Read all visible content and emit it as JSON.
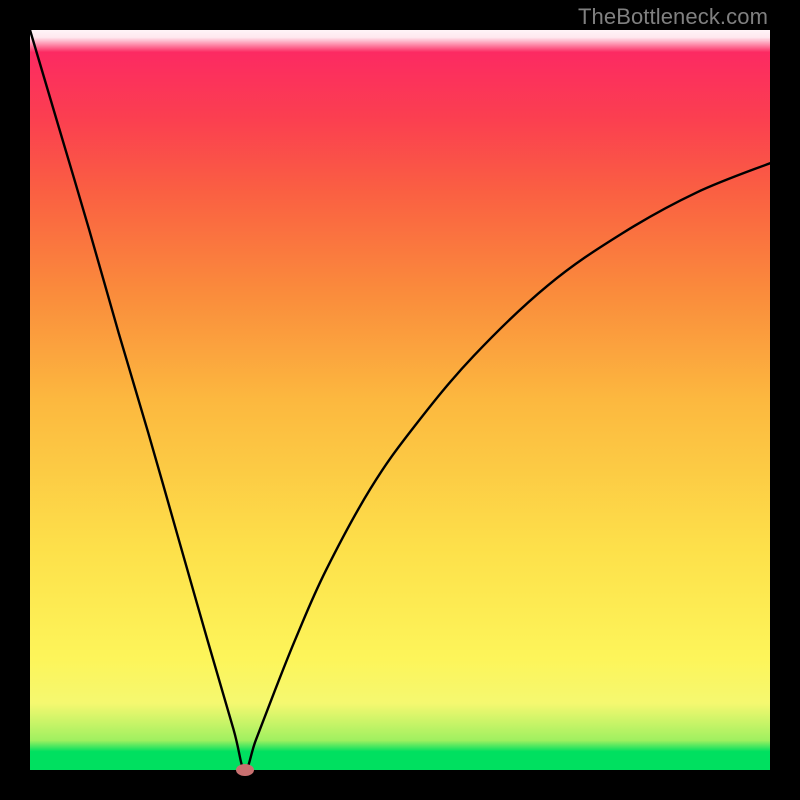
{
  "watermark": "TheBottleneck.com",
  "colors": {
    "marker": "#c97070",
    "curve_stroke": "#000000",
    "frame_bg": "#000000"
  },
  "chart_data": {
    "type": "line",
    "title": "",
    "xlabel": "",
    "ylabel": "",
    "xlim": [
      0,
      1
    ],
    "ylim": [
      0,
      1
    ],
    "grid": false,
    "legend": false,
    "notes": "Axes have no visible tick labels; values are normalized 0–1 estimated from pixel positions. The curve drops from top-left down to a minimum near x≈0.29 (y≈0), then rises concavely toward the top-right reaching y≈0.82 at x=1. A single marker sits at the minimum.",
    "series": [
      {
        "name": "bottleneck-curve",
        "x": [
          0.0,
          0.04,
          0.08,
          0.12,
          0.16,
          0.2,
          0.24,
          0.275,
          0.29,
          0.305,
          0.33,
          0.36,
          0.4,
          0.46,
          0.52,
          0.6,
          0.7,
          0.8,
          0.9,
          1.0
        ],
        "y": [
          1.0,
          0.865,
          0.73,
          0.59,
          0.455,
          0.315,
          0.175,
          0.055,
          0.0,
          0.04,
          0.105,
          0.18,
          0.27,
          0.38,
          0.465,
          0.56,
          0.655,
          0.725,
          0.78,
          0.82
        ]
      }
    ],
    "marker": {
      "x": 0.29,
      "y": 0.0
    }
  }
}
